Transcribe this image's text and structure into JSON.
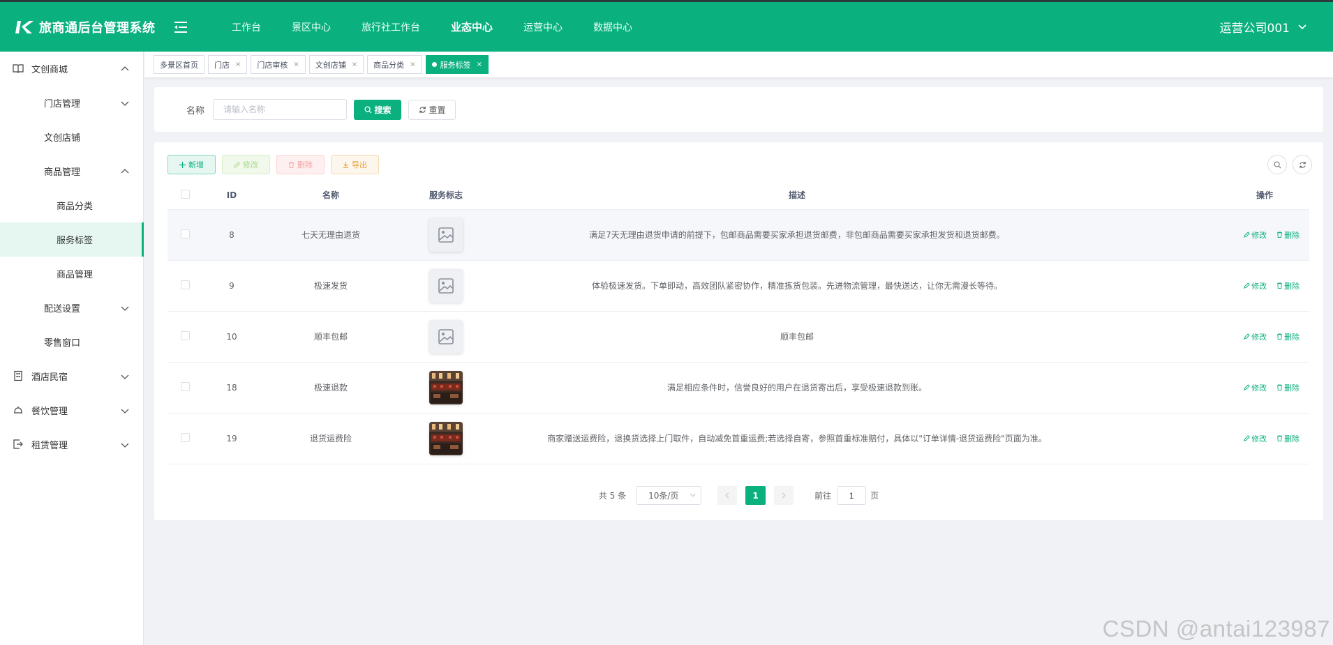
{
  "brand": {
    "title": "旅商通后台管理系统"
  },
  "topnav": [
    {
      "label": "工作台",
      "active": false
    },
    {
      "label": "景区中心",
      "active": false
    },
    {
      "label": "旅行社工作台",
      "active": false
    },
    {
      "label": "业态中心",
      "active": true
    },
    {
      "label": "运营中心",
      "active": false
    },
    {
      "label": "数据中心",
      "active": false
    }
  ],
  "account": {
    "name": "运营公司001"
  },
  "sidebar": {
    "items": [
      {
        "label": "文创商城"
      },
      {
        "label": "门店管理"
      },
      {
        "label": "文创店铺"
      },
      {
        "label": "商品管理"
      },
      {
        "label": "商品分类"
      },
      {
        "label": "服务标签"
      },
      {
        "label": "商品管理"
      },
      {
        "label": "配送设置"
      },
      {
        "label": "零售窗口"
      },
      {
        "label": "酒店民宿"
      },
      {
        "label": "餐饮管理"
      },
      {
        "label": "租赁管理"
      }
    ]
  },
  "tags": [
    {
      "label": "多景区首页"
    },
    {
      "label": "门店"
    },
    {
      "label": "门店审核"
    },
    {
      "label": "文创店铺"
    },
    {
      "label": "商品分类"
    },
    {
      "label": "服务标签"
    }
  ],
  "search": {
    "label": "名称",
    "placeholder": "请输入名称",
    "search_btn": "搜索",
    "reset_btn": "重置"
  },
  "toolbar": {
    "add": "新增",
    "edit": "修改",
    "delete": "删除",
    "export": "导出"
  },
  "table": {
    "headers": {
      "id": "ID",
      "name": "名称",
      "logo": "服务标志",
      "desc": "描述",
      "ops": "操作"
    },
    "rows": [
      {
        "id": "8",
        "name": "七天无理由退货",
        "logo": "placeholder",
        "desc": "满足7天无理由退货申请的前提下，包邮商品需要买家承担退货邮费，非包邮商品需要买家承担发货和退货邮费。"
      },
      {
        "id": "9",
        "name": "极速发货",
        "logo": "placeholder",
        "desc": "体验极速发货。下单即动，高效团队紧密协作，精准拣货包装。先进物流管理，最快送达，让你无需漫长等待。"
      },
      {
        "id": "10",
        "name": "顺丰包邮",
        "logo": "placeholder",
        "desc": "顺丰包邮"
      },
      {
        "id": "18",
        "name": "极速退款",
        "logo": "photo",
        "desc": "满足相应条件时，信誉良好的用户在退货寄出后，享受极速退款到账。"
      },
      {
        "id": "19",
        "name": "退货运费险",
        "logo": "photo",
        "desc": "商家赠送运费险，退换货选择上门取件，自动减免首重运费;若选择自寄，参照首重标准赔付，具体以\"订单详情-退货运费险\"页面为准。"
      }
    ],
    "op_edit": "修改",
    "op_delete": "删除"
  },
  "pagination": {
    "total": "共 5 条",
    "page_size": "10条/页",
    "current": "1",
    "goto": "前往",
    "goto_value": "1",
    "page_suffix": "页"
  },
  "watermark": "CSDN @antai123987",
  "colors": {
    "primary": "#0bb07f",
    "topbar": "#0bb07f"
  }
}
